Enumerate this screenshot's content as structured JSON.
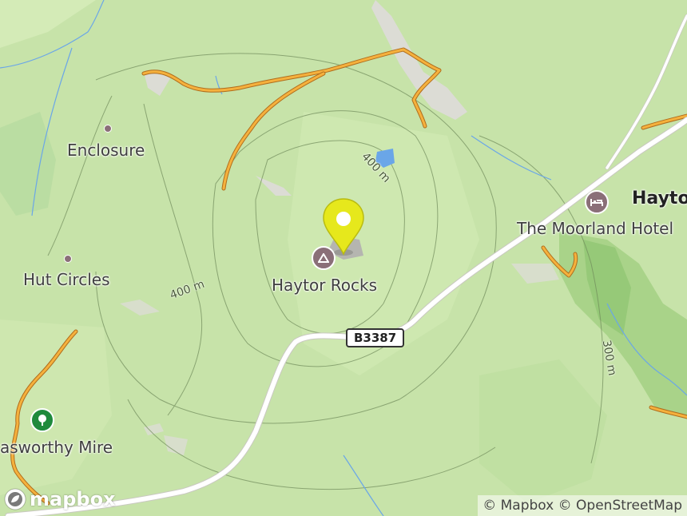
{
  "map": {
    "places": [
      {
        "id": "enclosure",
        "label": "Enclosure"
      },
      {
        "id": "hut-circles",
        "label": "Hut Circles"
      },
      {
        "id": "haytor-rocks",
        "label": "Haytor Rocks"
      },
      {
        "id": "haytor",
        "label": "Hayto"
      },
      {
        "id": "moorland-hotel",
        "label": "The Moorland Hotel"
      },
      {
        "id": "mire",
        "label": "asworthy Mire"
      }
    ],
    "contours": [
      "400 m",
      "400 m",
      "300 m"
    ],
    "road_ref": "B3387",
    "attribution": "© Mapbox © OpenStreetMap",
    "logo_text": "mapbox",
    "colors": {
      "land": "#c7e3a9",
      "road_minor": "#f5b13d",
      "road_main": "#ffffff",
      "water": "#6aa6e8",
      "marker": "#e6e81c",
      "poi_icon": "#8a6f78",
      "park_icon": "#1f8a3c"
    },
    "icons": {
      "peak": "mountain-icon",
      "hotel": "bed-icon",
      "park": "tree-icon",
      "marker": "map-pin-icon"
    }
  }
}
